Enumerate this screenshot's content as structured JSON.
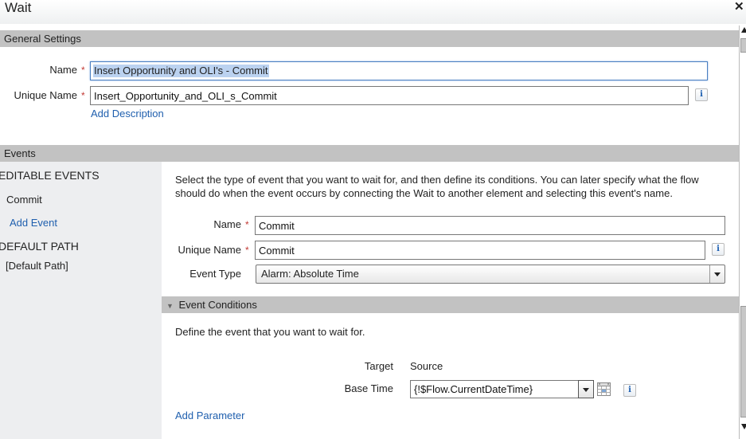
{
  "dialog": {
    "title": "Wait",
    "close_icon": "close-icon"
  },
  "general_settings": {
    "header": "General Settings",
    "name_label": "Name",
    "name_value": "Insert Opportunity and OLI's - Commit",
    "unique_name_label": "Unique Name",
    "unique_name_value": "Insert_Opportunity_and_OLI_s_Commit",
    "required_marker": "*",
    "info_icon": "i",
    "add_description": "Add Description"
  },
  "events": {
    "header": "Events",
    "sidebar": {
      "editable_heading": "EDITABLE EVENTS",
      "editable_items": [
        "Commit"
      ],
      "add_event": "Add Event",
      "default_heading": "DEFAULT PATH",
      "default_items": [
        "[Default Path]"
      ]
    },
    "detail": {
      "instructions": "Select the type of event that you want to wait for, and then define its conditions. You can later specify what the flow should do when the event occurs by connecting the Wait to another element and selecting this event's name.",
      "name_label": "Name",
      "name_value": "Commit",
      "unique_name_label": "Unique Name",
      "unique_name_value": "Commit",
      "event_type_label": "Event Type",
      "event_type_value": "Alarm: Absolute Time",
      "conditions": {
        "header": "Event Conditions",
        "description": "Define the event that you want to wait for.",
        "target_col": "Target",
        "source_col": "Source",
        "base_time_label": "Base Time",
        "base_time_value": "{!$Flow.CurrentDateTime}",
        "add_parameter": "Add Parameter"
      }
    }
  },
  "colors": {
    "section_header": "#c2c2c2",
    "link": "#1f5fae",
    "required": "#c23934",
    "left_panel": "#edeef0"
  }
}
